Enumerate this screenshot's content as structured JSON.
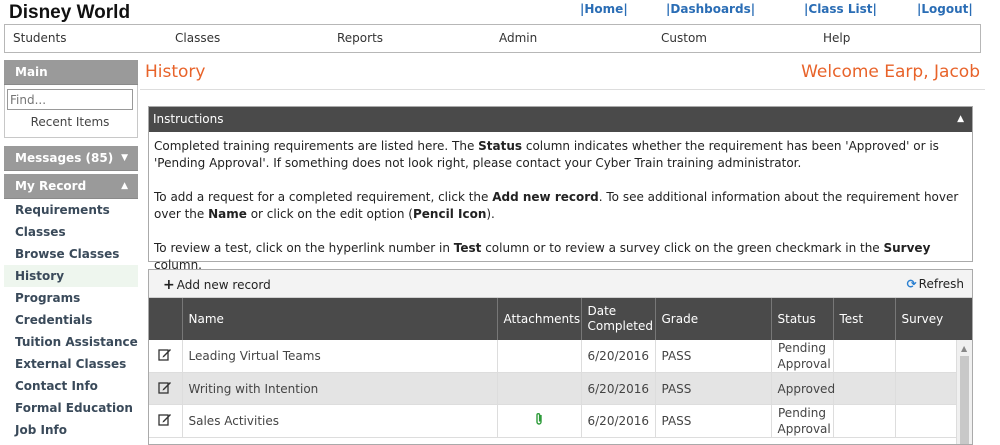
{
  "header": {
    "brand": "Disney World",
    "links": [
      "|Home|",
      "|Dashboards|",
      "|Class List|",
      "|Logout|"
    ]
  },
  "menu": [
    "Students",
    "Classes",
    "Reports",
    "Admin",
    "Custom",
    "Help"
  ],
  "sidebar": {
    "main_label": "Main",
    "find_placeholder": "Find...",
    "recent_items": "Recent Items",
    "messages_label": "Messages (85)",
    "my_record_label": "My Record",
    "items": [
      "Requirements",
      "Classes",
      "Browse Classes",
      "History",
      "Programs",
      "Credentials",
      "Tuition Assistance",
      "External Classes",
      "Contact Info",
      "Formal Education",
      "Job Info"
    ],
    "active_item": "History"
  },
  "page": {
    "title": "History",
    "welcome": "Welcome Earp, Jacob"
  },
  "instructions": {
    "title": "Instructions",
    "p1_a": "Completed training requirements are listed here.  The ",
    "p1_b": "Status",
    "p1_c": " column indicates whether the requirement has been 'Approved' or is 'Pending Approval'.  If something does not look right, please contact your Cyber Train training administrator.",
    "p2_a": "To add a request for a completed requirement, click the ",
    "p2_b": "Add new record",
    "p2_c": ".  To see additional information about the requirement hover over the ",
    "p2_d": "Name",
    "p2_e": " or click on the edit option (",
    "p2_f": "Pencil Icon",
    "p2_g": ").",
    "p3_a": "To review a test, click on the hyperlink number in ",
    "p3_b": "Test",
    "p3_c": " column or to review a survey click on the green checkmark in the ",
    "p3_d": "Survey",
    "p3_e": " column."
  },
  "grid": {
    "add_label": "Add new record",
    "refresh_label": "Refresh",
    "columns": [
      "Name",
      "Attachments",
      "Date Completed",
      "Grade",
      "Status",
      "Test",
      "Survey"
    ],
    "rows": [
      {
        "name": "Leading Virtual Teams",
        "attachment": "",
        "date": "6/20/2016",
        "grade": "PASS",
        "status": "Pending Approval",
        "test": "",
        "survey": ""
      },
      {
        "name": "Writing with Intention",
        "attachment": "",
        "date": "6/20/2016",
        "grade": "PASS",
        "status": "Approved",
        "test": "",
        "survey": ""
      },
      {
        "name": "Sales Activities",
        "attachment": "paperclip-icon",
        "date": "6/20/2016",
        "grade": "PASS",
        "status": "Pending Approval",
        "test": "",
        "survey": ""
      }
    ]
  }
}
